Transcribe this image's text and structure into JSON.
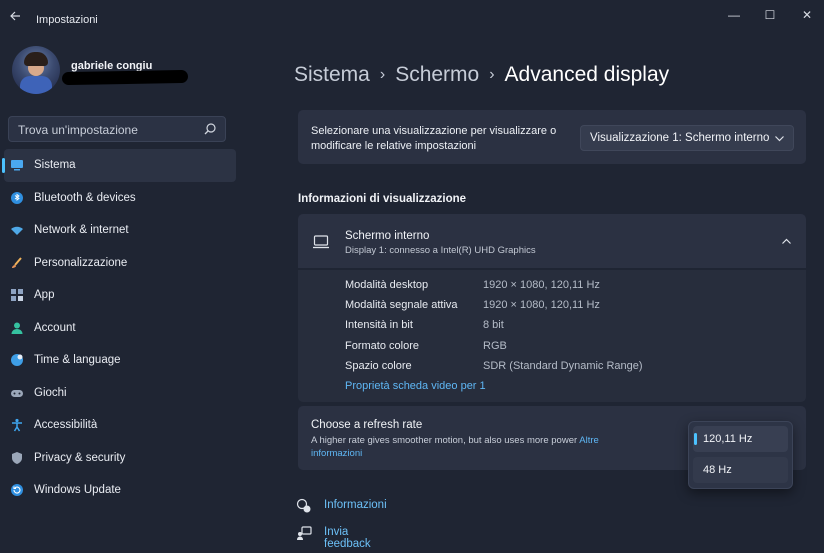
{
  "window": {
    "title": "Impostazioni",
    "controls": {
      "minimize": "—",
      "maximize": "☐",
      "close": "✕"
    }
  },
  "profile": {
    "name": "gabriele congiu"
  },
  "search": {
    "placeholder": "Trova un'impostazione"
  },
  "sidebar": {
    "items": [
      {
        "label": "Sistema",
        "icon": "system-icon",
        "active": true
      },
      {
        "label": "Bluetooth & devices",
        "icon": "bluetooth-icon"
      },
      {
        "label": "Network & internet",
        "icon": "network-icon"
      },
      {
        "label": "Personalizzazione",
        "icon": "brush-icon"
      },
      {
        "label": "App",
        "icon": "apps-icon"
      },
      {
        "label": "Account",
        "icon": "account-icon"
      },
      {
        "label": "Time & language",
        "icon": "globe-icon"
      },
      {
        "label": "Giochi",
        "icon": "gamepad-icon"
      },
      {
        "label": "Accessibilità",
        "icon": "accessibility-icon"
      },
      {
        "label": "Privacy & security",
        "icon": "shield-icon"
      },
      {
        "label": "Windows Update",
        "icon": "update-icon"
      }
    ]
  },
  "breadcrumb": {
    "items": [
      "Sistema",
      "Schermo"
    ],
    "separator": "›",
    "current": "Advanced display"
  },
  "display_select": {
    "description": "Selezionare una visualizzazione per visualizzare o modificare le relative impostazioni",
    "selected": "Visualizzazione 1: Schermo interno"
  },
  "display_info": {
    "section_title": "Informazioni di visualizzazione",
    "name": "Schermo interno",
    "subtitle": "Display 1: connesso a Intel(R) UHD Graphics",
    "rows": [
      {
        "key": "Modalità desktop",
        "value": "1920 × 1080, 120,11 Hz"
      },
      {
        "key": "Modalità segnale attiva",
        "value": "1920 × 1080, 120,11 Hz"
      },
      {
        "key": "Intensità in bit",
        "value": "8 bit"
      },
      {
        "key": "Formato colore",
        "value": "RGB"
      },
      {
        "key": "Spazio colore",
        "value": "SDR (Standard Dynamic Range)"
      }
    ],
    "adapter_link": "Proprietà scheda video per 1"
  },
  "refresh_rate": {
    "title": "Choose a refresh rate",
    "description": "A higher rate gives smoother motion, but also uses more power",
    "link": "Altre informazioni",
    "options": [
      "120,11 Hz",
      "48 Hz"
    ],
    "selected": "120,11 Hz"
  },
  "footer": {
    "info": "Informazioni",
    "feedback": "Invia feedback"
  },
  "colors": {
    "background": "#1f2533",
    "card": "#2b3142",
    "accent": "#4cc2ff",
    "link": "#5fb7f5"
  }
}
